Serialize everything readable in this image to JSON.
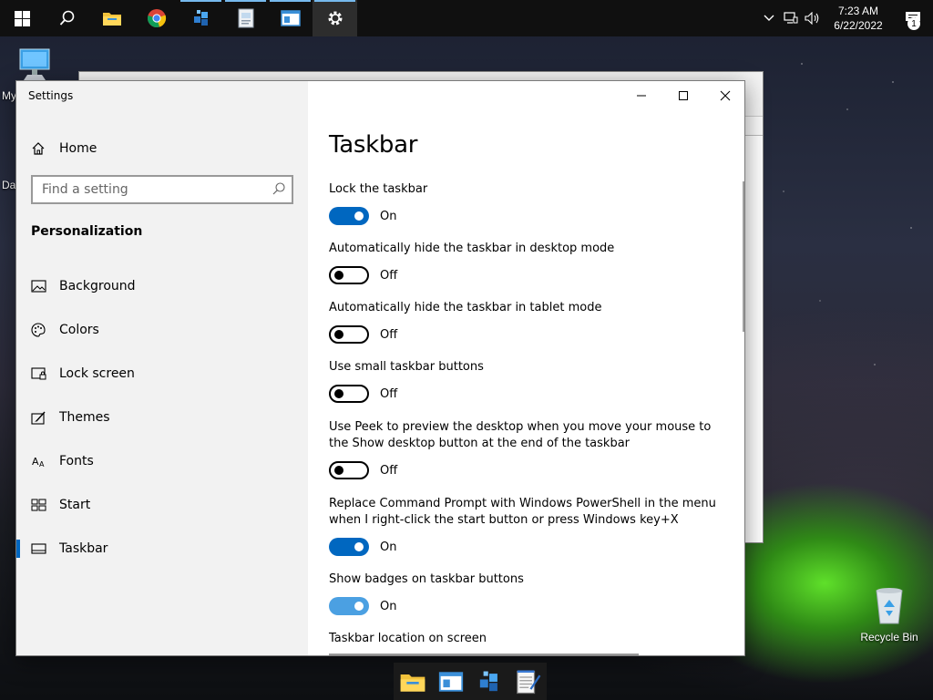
{
  "taskbar": {
    "icons": [
      {
        "name": "start-icon",
        "active": false,
        "running": false
      },
      {
        "name": "search-icon",
        "active": false,
        "running": false
      },
      {
        "name": "file-explorer-icon",
        "active": false,
        "running": false
      },
      {
        "name": "chrome-icon",
        "active": false,
        "running": false
      },
      {
        "name": "app-cubes-icon",
        "active": false,
        "running": true
      },
      {
        "name": "document-app-icon",
        "active": false,
        "running": true
      },
      {
        "name": "window-app-icon",
        "active": false,
        "running": true
      },
      {
        "name": "settings-gear-icon",
        "active": true,
        "running": true
      }
    ],
    "clock_time": "7:23 AM",
    "clock_date": "6/22/2022",
    "notification_count": "1"
  },
  "desktop": {
    "icon_my_label": "My",
    "icon_da_label": "Da",
    "recycle_bin_label": "Recycle Bin"
  },
  "dock": {
    "items": [
      "file-explorer-icon",
      "window-app-icon",
      "app-cubes-icon",
      "notepad-icon"
    ]
  },
  "settings": {
    "app_title": "Settings",
    "home_label": "Home",
    "search_placeholder": "Find a setting",
    "section_title": "Personalization",
    "nav": [
      {
        "label": "Background",
        "icon": "picture-icon"
      },
      {
        "label": "Colors",
        "icon": "palette-icon"
      },
      {
        "label": "Lock screen",
        "icon": "lock-screen-icon"
      },
      {
        "label": "Themes",
        "icon": "themes-icon"
      },
      {
        "label": "Fonts",
        "icon": "fonts-icon"
      },
      {
        "label": "Start",
        "icon": "start-tiles-icon"
      },
      {
        "label": "Taskbar",
        "icon": "taskbar-icon",
        "selected": true
      }
    ],
    "page_title": "Taskbar",
    "settings": [
      {
        "desc": "Lock the taskbar",
        "state": "On",
        "on": true
      },
      {
        "desc": "Automatically hide the taskbar in desktop mode",
        "state": "Off",
        "on": false
      },
      {
        "desc": "Automatically hide the taskbar in tablet mode",
        "state": "Off",
        "on": false
      },
      {
        "desc": "Use small taskbar buttons",
        "state": "Off",
        "on": false
      },
      {
        "desc": "Use Peek to preview the desktop when you move your mouse to the Show desktop button at the end of the taskbar",
        "state": "Off",
        "on": false
      },
      {
        "desc": "Replace Command Prompt with Windows PowerShell in the menu when I right-click the start button or press Windows key+X",
        "state": "On",
        "on": true
      },
      {
        "desc": "Show badges on taskbar buttons",
        "state": "On",
        "on": true
      }
    ],
    "taskbar_location_label": "Taskbar location on screen"
  },
  "colors": {
    "accent": "#0067c0",
    "accent_light": "#4ba0e2"
  }
}
